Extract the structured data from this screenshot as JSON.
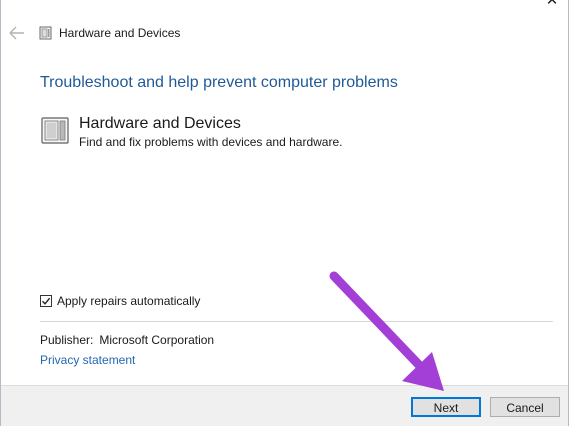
{
  "window": {
    "title": "Hardware and Devices",
    "close_glyph": "✕",
    "back_icon": "back-arrow-icon",
    "title_icon": "hardware-device-icon"
  },
  "main": {
    "heading": "Troubleshoot and help prevent computer problems",
    "item": {
      "icon": "hardware-device-icon",
      "title": "Hardware and Devices",
      "description": "Find and fix problems with devices and hardware."
    },
    "apply_repairs": {
      "label": "Apply repairs automatically",
      "checked": true
    },
    "publisher": {
      "label": "Publisher:",
      "value": "Microsoft Corporation"
    },
    "privacy_link": "Privacy statement"
  },
  "footer": {
    "next_label": "Next",
    "cancel_label": "Cancel"
  },
  "colors": {
    "heading": "#1f5a96",
    "link": "#2467b1",
    "focus_border": "#0078d7",
    "annotation_arrow": "#a33fd6"
  }
}
